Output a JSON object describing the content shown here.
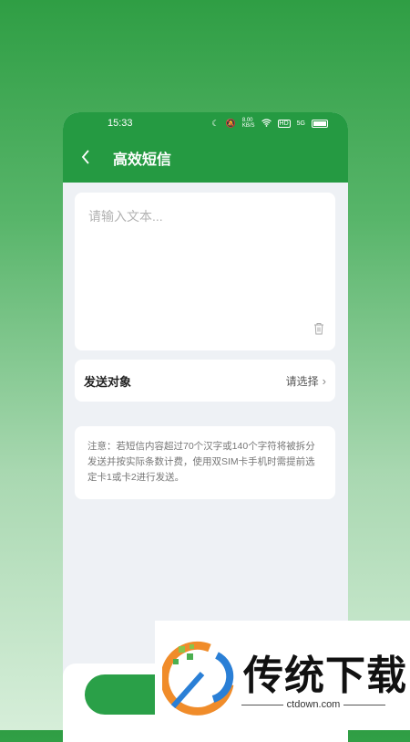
{
  "status": {
    "time": "15:33",
    "speed": "8.00\nKB/S",
    "hd": "HD",
    "signal": "5G"
  },
  "header": {
    "title": "高效短信"
  },
  "message": {
    "placeholder": "请输入文本..."
  },
  "target": {
    "label": "发送对象",
    "value": "请选择",
    "chevron": "›"
  },
  "notice": {
    "text": "注意：若短信内容超过70个汉字或140个字符将被拆分发送并按实际条数计费，使用双SIM卡手机时需提前选定卡1或卡2进行发送。"
  },
  "watermark": {
    "name": "传统下载",
    "url": "ctdown.com"
  },
  "colors": {
    "accent": "#259a42",
    "button": "#2aa048"
  },
  "icons": [
    "moon-icon",
    "mute-icon",
    "wifi-icon",
    "battery-icon",
    "back-chevron-icon",
    "trash-icon",
    "chevron-right-icon",
    "logo-icon"
  ]
}
